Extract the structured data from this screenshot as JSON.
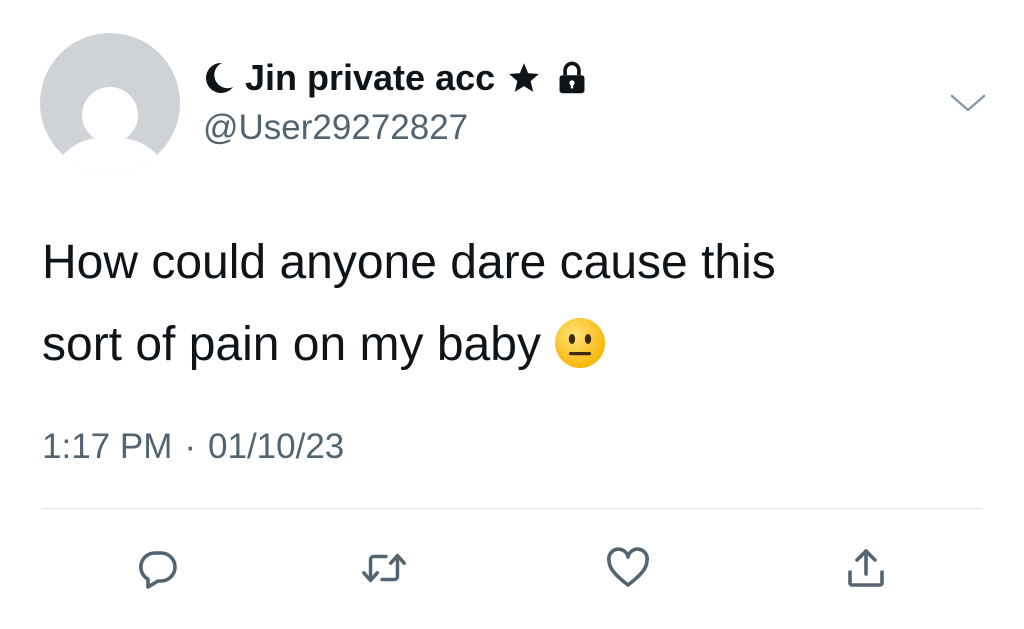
{
  "tweet": {
    "display_name": "Jin private acc",
    "handle": "@User29272827",
    "text_line1": "How could anyone dare cause this",
    "text_line2": "sort of pain on my baby",
    "time": "1:17 PM",
    "separator": "·",
    "date": "01/10/23"
  },
  "icons": {
    "name_prefix": "crescent-moon-icon",
    "name_suffix_1": "star-icon",
    "name_suffix_2": "lock-icon",
    "emoji": "neutral-face-emoji",
    "menu": "chevron-down-icon",
    "actions": [
      "reply-icon",
      "retweet-icon",
      "like-icon",
      "share-icon"
    ]
  },
  "colors": {
    "primary_text": "#0f1419",
    "secondary_text": "#536471",
    "icon": "#536471",
    "divider": "#dbe0e4",
    "avatar_bg": "#cfd2d6"
  }
}
